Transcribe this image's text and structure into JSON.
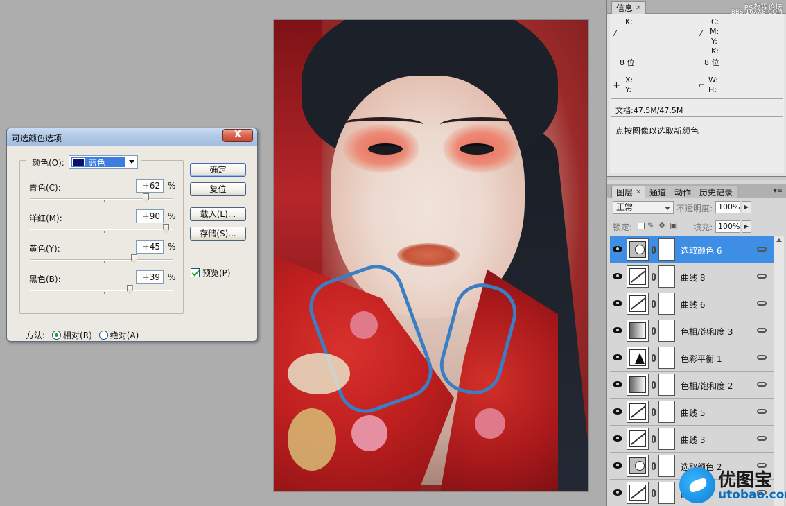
{
  "dialog": {
    "title": "可选颜色选项",
    "close_label": "X",
    "color_label": "颜色(O):",
    "color_value": "蓝色",
    "sliders": [
      {
        "label": "青色(C):",
        "value": "+62",
        "unit": "%",
        "level": 0.81
      },
      {
        "label": "洋红(M):",
        "value": "+90",
        "unit": "%",
        "level": 0.95
      },
      {
        "label": "黄色(Y):",
        "value": "+45",
        "unit": "%",
        "level": 0.725
      },
      {
        "label": "黑色(B):",
        "value": "+39",
        "unit": "%",
        "level": 0.695
      }
    ],
    "buttons": {
      "ok": "确定",
      "reset": "复位",
      "load": "载入(L)...",
      "save": "存储(S)..."
    },
    "preview_label": "预览(P)",
    "method_label": "方法:",
    "method_relative": "相对(R)",
    "method_absolute": "绝对(A)",
    "method_selected": "relative"
  },
  "info_panel": {
    "tab_label": "信息",
    "k_label": "K:",
    "cmyk_labels": [
      "C:",
      "M:",
      "Y:",
      "K:"
    ],
    "bit_left": "8 位",
    "bit_right": "8 位",
    "x_label": "X:",
    "y_label": "Y:",
    "w_label": "W:",
    "h_label": "H:",
    "doc_size": "文档:47.5M/47.5M",
    "hint": "点按图像以选取新颜色"
  },
  "layers_panel": {
    "tabs": [
      "图层",
      "通道",
      "动作",
      "历史记录"
    ],
    "blend_mode": "正常",
    "opacity_label": "不透明度:",
    "opacity_value": "100%",
    "lock_label": "锁定:",
    "fill_label": "填充:",
    "fill_value": "100%",
    "layers": [
      {
        "name": "选取颜色 6",
        "type": "selective-color",
        "selected": true
      },
      {
        "name": "曲线 8",
        "type": "curves",
        "selected": false
      },
      {
        "name": "曲线 6",
        "type": "curves",
        "selected": false
      },
      {
        "name": "色相/饱和度 3",
        "type": "hue-saturation",
        "selected": false
      },
      {
        "name": "色彩平衡 1",
        "type": "color-balance",
        "selected": false
      },
      {
        "name": "色相/饱和度 2",
        "type": "hue-saturation",
        "selected": false
      },
      {
        "name": "曲线 5",
        "type": "curves",
        "selected": false
      },
      {
        "name": "曲线 3",
        "type": "curves",
        "selected": false
      },
      {
        "name": "选取颜色 2",
        "type": "selective-color",
        "selected": false
      },
      {
        "name": "曲线",
        "type": "curves",
        "selected": false
      }
    ]
  },
  "corner_watermark": {
    "line1": "PS教程论坛",
    "line2": "BBS.16XX8.COM"
  },
  "watermark": {
    "brand": "优图宝",
    "domain": "utobao.com"
  },
  "colors": {
    "accent_selected": "#3e8ee6",
    "dialog_bg": "#ece9e2",
    "close_red": "#c8462f",
    "color_swatch": "#0b0f6b"
  }
}
